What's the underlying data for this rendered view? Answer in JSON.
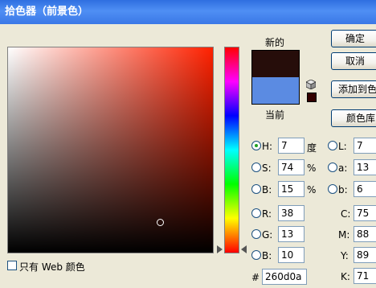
{
  "window": {
    "title": "拾色器（前景色）"
  },
  "preview": {
    "new_label": "新的",
    "current_label": "当前",
    "new_color": "#260d0a",
    "current_color": "#5b8be2"
  },
  "buttons": {
    "ok": "确定",
    "cancel": "取消",
    "add_to_swatches": "添加到色",
    "color_libraries": "颜色库"
  },
  "hsb": [
    {
      "label": "H:",
      "value": "7",
      "unit": "度",
      "checked": true
    },
    {
      "label": "S:",
      "value": "74",
      "unit": "%",
      "checked": false
    },
    {
      "label": "B:",
      "value": "15",
      "unit": "%",
      "checked": false
    }
  ],
  "rgb": [
    {
      "label": "R:",
      "value": "38"
    },
    {
      "label": "G:",
      "value": "13"
    },
    {
      "label": "B:",
      "value": "10"
    }
  ],
  "lab": [
    {
      "label": "L:",
      "value": "7"
    },
    {
      "label": "a:",
      "value": "13"
    },
    {
      "label": "b:",
      "value": "6"
    }
  ],
  "cmyk": [
    {
      "label": "C:",
      "value": "75"
    },
    {
      "label": "M:",
      "value": "88"
    },
    {
      "label": "Y:",
      "value": "89"
    },
    {
      "label": "K:",
      "value": "71"
    }
  ],
  "hex": {
    "hash": "#",
    "value": "260d0a"
  },
  "web_only": {
    "label": "只有 Web 颜色",
    "checked": false
  },
  "colors": {
    "hue_base": "#ff2100",
    "titlebar": "#3a78e6"
  }
}
